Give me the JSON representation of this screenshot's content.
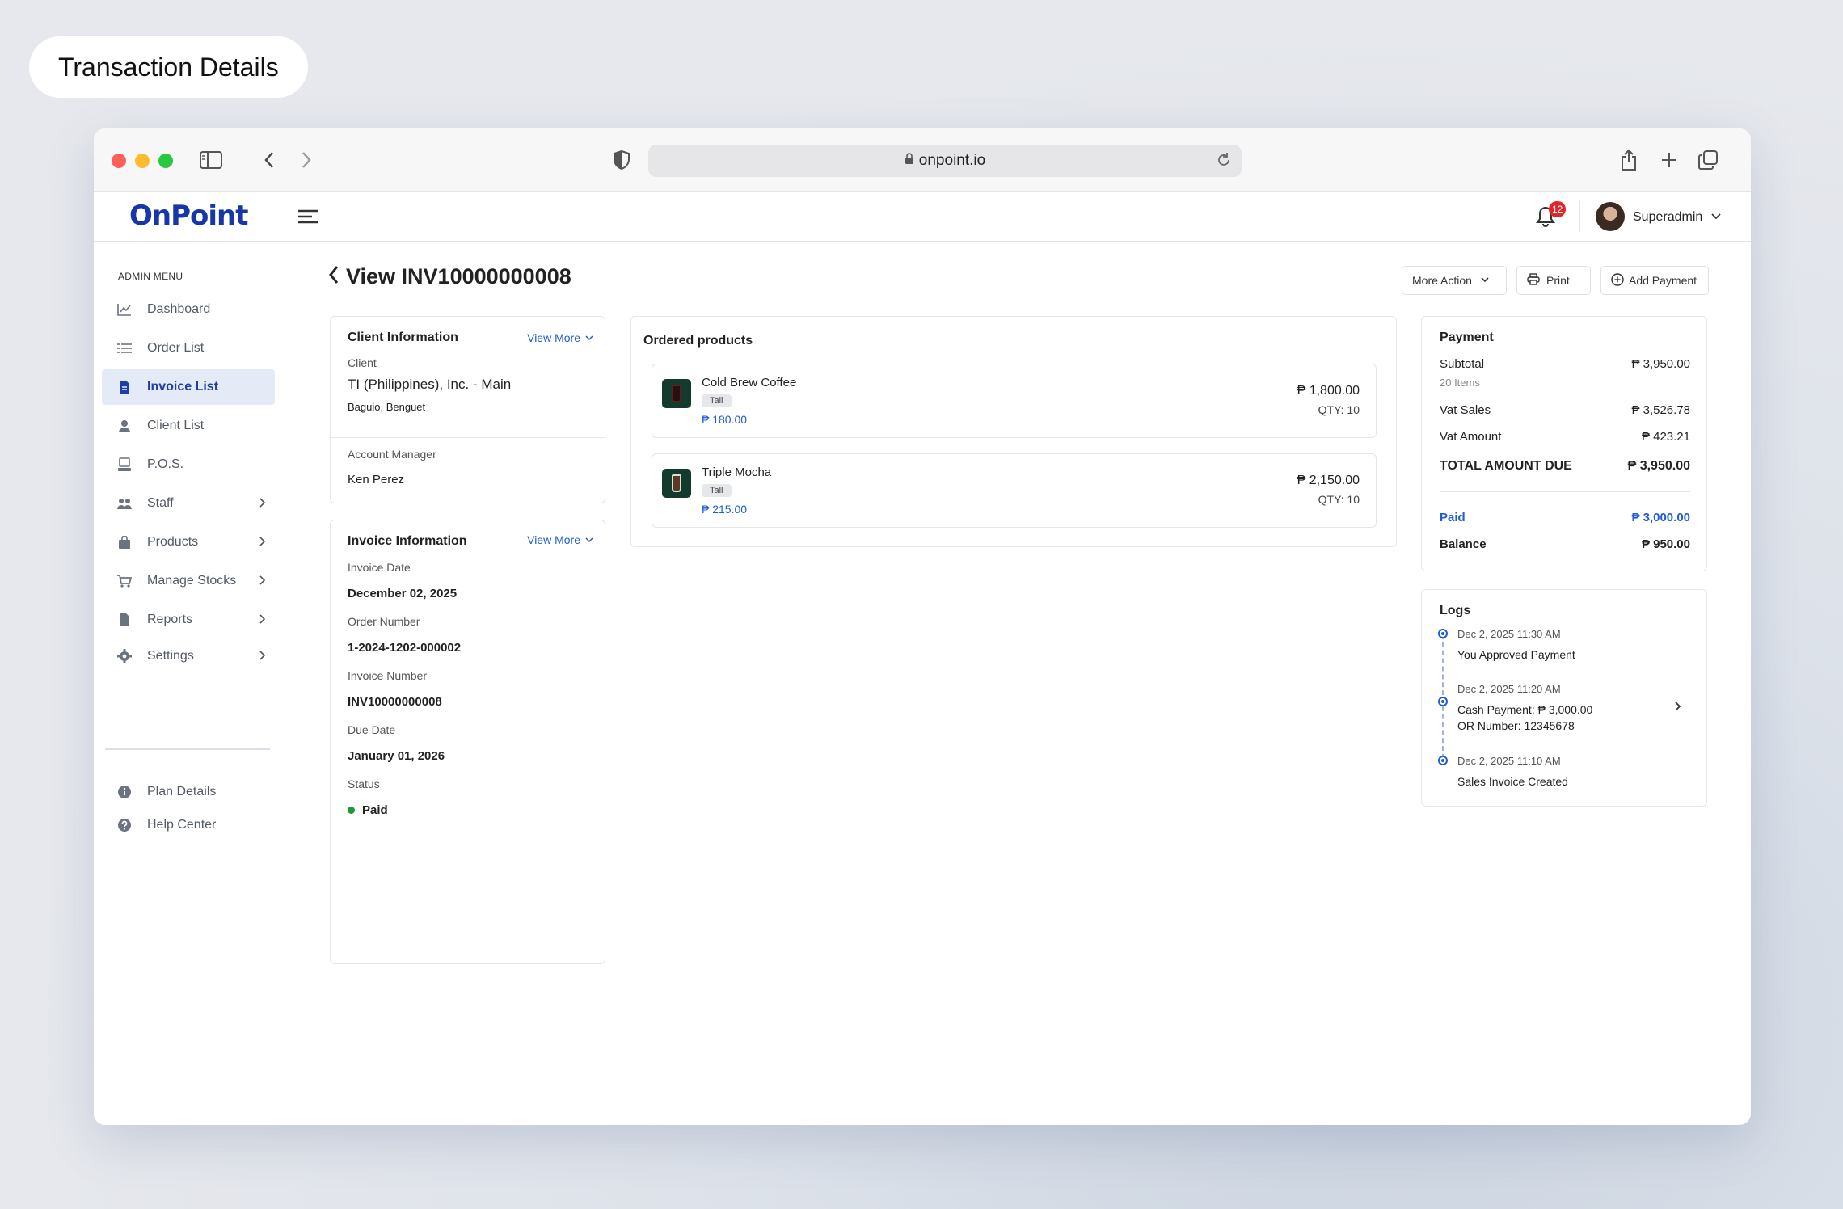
{
  "page_label": "Transaction Details",
  "browser": {
    "url": "onpoint.io"
  },
  "app": {
    "logo": "OnPoint",
    "notifications_count": "12",
    "user_name": "Superadmin"
  },
  "sidebar": {
    "menu_label": "ADMIN MENU",
    "items": [
      {
        "label": "Dashboard",
        "icon": "chart-line-icon"
      },
      {
        "label": "Order List",
        "icon": "list-icon"
      },
      {
        "label": "Invoice List",
        "icon": "document-icon",
        "active": true
      },
      {
        "label": "Client List",
        "icon": "user-icon"
      },
      {
        "label": "P.O.S.",
        "icon": "pos-terminal-icon"
      },
      {
        "label": "Staff",
        "icon": "users-icon",
        "has_submenu": true
      },
      {
        "label": "Products",
        "icon": "bag-icon",
        "has_submenu": true
      },
      {
        "label": "Manage Stocks",
        "icon": "cart-icon",
        "has_submenu": true
      },
      {
        "label": "Reports",
        "icon": "file-icon",
        "has_submenu": true
      },
      {
        "label": "Settings",
        "icon": "gear-icon",
        "has_submenu": true
      }
    ],
    "footer_items": [
      {
        "label": "Plan Details",
        "icon": "info-icon"
      },
      {
        "label": "Help Center",
        "icon": "help-icon"
      }
    ]
  },
  "main": {
    "title": "View INV10000000008",
    "actions": {
      "more_action": "More Action",
      "print": "Print",
      "add_payment": "Add Payment"
    },
    "client_info": {
      "title": "Client Information",
      "view_more": "View More",
      "client_label": "Client",
      "client_name": "TI (Philippines), Inc. - Main",
      "client_location": "Baguio, Benguet",
      "manager_label": "Account Manager",
      "manager_name": "Ken Perez"
    },
    "invoice_info": {
      "title": "Invoice Information",
      "view_more": "View More",
      "invoice_date_label": "Invoice Date",
      "invoice_date": "December 02, 2025",
      "order_number_label": "Order Number",
      "order_number": "1-2024-1202-000002",
      "invoice_number_label": "Invoice Number",
      "invoice_number": "INV10000000008",
      "due_date_label": "Due Date",
      "due_date": "January 01, 2026",
      "status_label": "Status",
      "status": "Paid",
      "status_color": "#1a9b3a"
    },
    "ordered_products": {
      "title": "Ordered products",
      "items": [
        {
          "name": "Cold Brew Coffee",
          "size": "Tall",
          "unit_price": "₱ 180.00",
          "total": "₱ 1,800.00",
          "qty": "QTY: 10"
        },
        {
          "name": "Triple Mocha",
          "size": "Tall",
          "unit_price": "₱ 215.00",
          "total": "₱ 2,150.00",
          "qty": "QTY: 10"
        }
      ]
    },
    "payment": {
      "title": "Payment",
      "subtotal_label": "Subtotal",
      "subtotal": "₱ 3,950.00",
      "items_count": "20 Items",
      "vat_sales_label": "Vat Sales",
      "vat_sales": "₱ 3,526.78",
      "vat_amount_label": "Vat Amount",
      "vat_amount": "₱ 423.21",
      "total_label": "TOTAL AMOUNT DUE",
      "total": "₱ 3,950.00",
      "paid_label": "Paid",
      "paid": "₱ 3,000.00",
      "balance_label": "Balance",
      "balance": "₱ 950.00"
    },
    "logs": {
      "title": "Logs",
      "entries": [
        {
          "time": "Dec 2, 2025 11:30 AM",
          "text": "You Approved Payment"
        },
        {
          "time": "Dec 2, 2025 11:20 AM",
          "text": "Cash Payment: ₱ 3,000.00",
          "text2": "OR Number: 12345678"
        },
        {
          "time": "Dec 2, 2025 11:10 AM",
          "text": "Sales Invoice Created"
        }
      ]
    }
  },
  "colors": {
    "accent": "#1f3ea8",
    "link": "#1f5cd6",
    "badge": "#e0242b"
  }
}
